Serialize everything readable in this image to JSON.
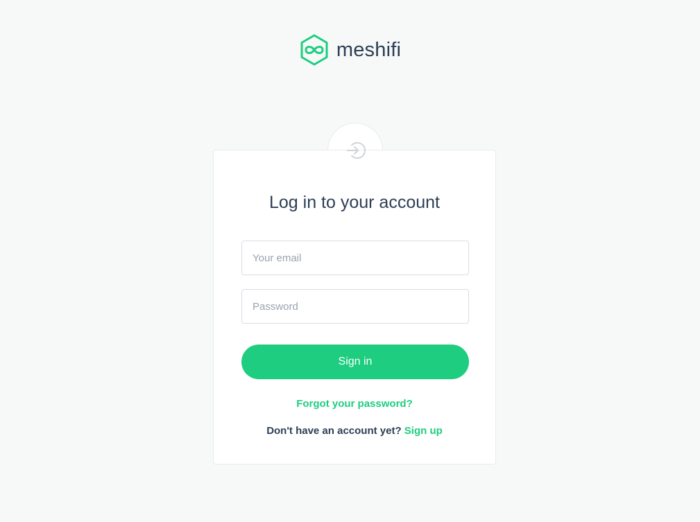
{
  "brand": {
    "name": "meshifi",
    "logo_icon": "hexagon-infinity-icon",
    "logo_color": "#1ecd7f",
    "text_color": "#2d3e55"
  },
  "card": {
    "badge_icon": "login-arrow-icon",
    "title": "Log in to your account"
  },
  "form": {
    "email": {
      "value": "",
      "placeholder": "Your email"
    },
    "password": {
      "value": "",
      "placeholder": "Password"
    },
    "submit_label": "Sign in"
  },
  "links": {
    "forgot_password": "Forgot your password?",
    "no_account_text": "Don't have an account yet?",
    "sign_up": "Sign up"
  },
  "colors": {
    "accent": "#1ecd7f",
    "background": "#f7f9f8",
    "card": "#ffffff",
    "border": "#e7eaed",
    "placeholder": "#9aa4b0"
  }
}
